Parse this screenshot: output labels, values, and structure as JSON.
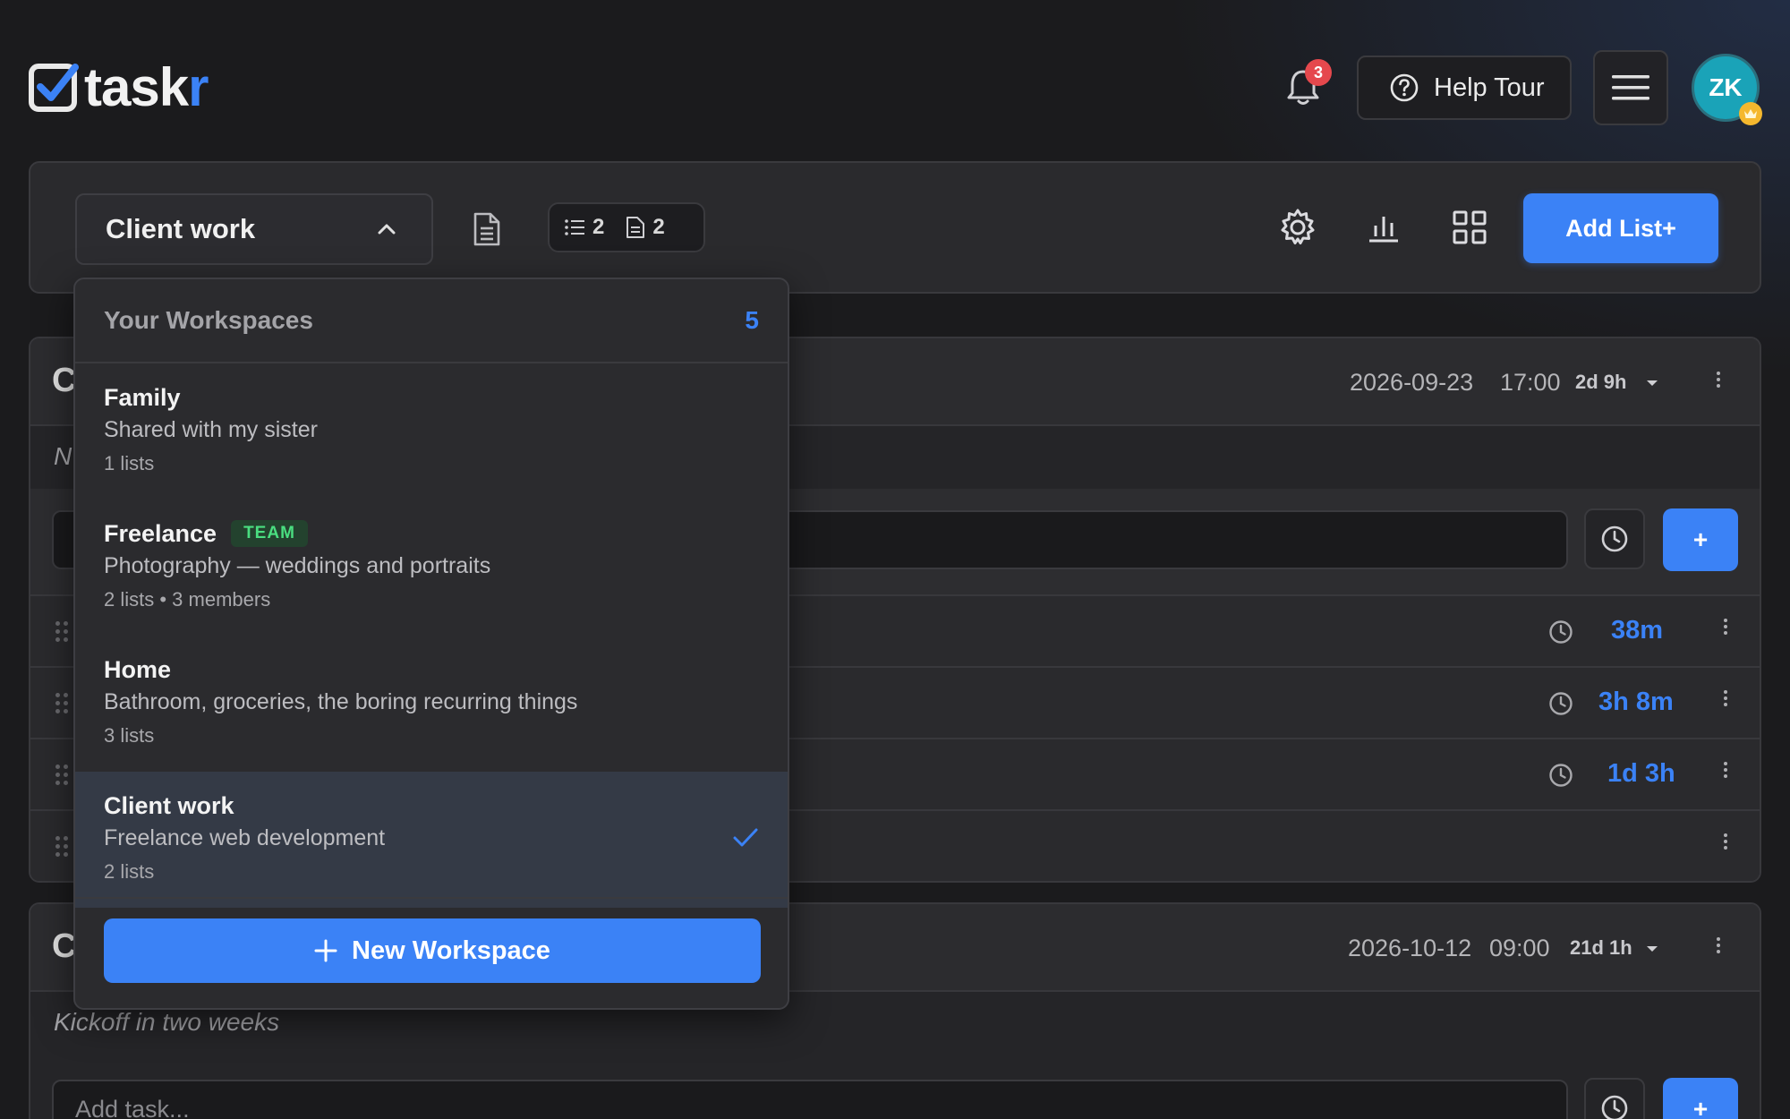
{
  "header": {
    "logo_main": "task",
    "logo_accent": "r",
    "notifications_count": "3",
    "help_label": "Help Tour",
    "avatar_initials": "ZK"
  },
  "toolbar": {
    "workspace_selected": "Client work",
    "lists_count": "2",
    "docs_count": "2",
    "add_list_label": "Add List+"
  },
  "lists": [
    {
      "title": "C",
      "date": "2026-09-23",
      "time": "17:00",
      "remaining": "2d 9h",
      "note": "N",
      "tasks": [
        {
          "time": "38m"
        },
        {
          "time": "3h 8m"
        },
        {
          "time": "1d 3h"
        },
        {
          "time": ""
        }
      ],
      "add_button": "+"
    },
    {
      "title": "C",
      "date": "2026-10-12",
      "time": "09:00",
      "remaining": "21d 1h",
      "note": "Kickoff in two weeks",
      "add_placeholder": "Add task...",
      "add_button": "+"
    }
  ],
  "dropdown": {
    "title": "Your Workspaces",
    "count": "5",
    "workspaces": [
      {
        "name": "Family",
        "description": "Shared with my sister",
        "meta": "1 lists",
        "badge": ""
      },
      {
        "name": "Freelance",
        "description": "Photography — weddings and portraits",
        "meta": "2 lists • 3 members",
        "badge": "TEAM"
      },
      {
        "name": "Home",
        "description": "Bathroom, groceries, the boring recurring things",
        "meta": "3 lists",
        "badge": ""
      },
      {
        "name": "Client work",
        "description": "Freelance web development",
        "meta": "2 lists",
        "badge": "",
        "selected": true
      }
    ],
    "new_workspace_label": "New Workspace"
  },
  "colors": {
    "accent": "#3b82f6",
    "background": "#1b1b1d",
    "badge_red": "#e5484d",
    "team_green": "#4ade80",
    "avatar": "#1aa3b8",
    "crown": "#f5b82e"
  },
  "icons": [
    "check-square-logo-icon",
    "bell-icon",
    "help-circle-icon",
    "hamburger-menu-icon",
    "crown-icon",
    "chevron-up-icon",
    "document-icon",
    "list-icon",
    "gear-icon",
    "bar-chart-icon",
    "grid-icon",
    "clock-icon",
    "kebab-icon",
    "drag-handle-icon",
    "caret-down-icon",
    "checkmark-icon",
    "plus-icon"
  ]
}
